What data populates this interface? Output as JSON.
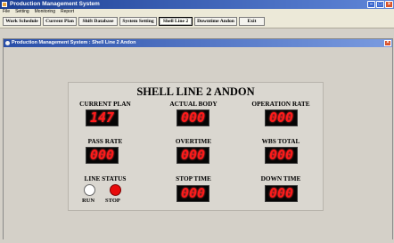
{
  "window": {
    "title": "Production Management System"
  },
  "menu": [
    "File",
    "Setting",
    "Monitoring",
    "Report"
  ],
  "toolbar": [
    {
      "label": "Work Schedule",
      "active": false
    },
    {
      "label": "Current Plan",
      "active": false
    },
    {
      "label": "Shift Database",
      "active": false
    },
    {
      "label": "System Setting",
      "active": false
    },
    {
      "label": "Shell Line 2",
      "active": true
    },
    {
      "label": "Downtime Andon",
      "active": false
    },
    {
      "label": "Exit",
      "active": false
    }
  ],
  "child_window": {
    "title": "Production Management System : Shell Line 2 Andon"
  },
  "andon": {
    "title": "SHELL LINE 2 ANDON",
    "current_plan": {
      "label": "CURRENT PLAN",
      "value": "147"
    },
    "actual_body": {
      "label": "ACTUAL BODY",
      "value": "000"
    },
    "operation_rate": {
      "label": "OPERATION RATE",
      "value": "000"
    },
    "pass_rate": {
      "label": "PASS RATE",
      "value": "000"
    },
    "overtime": {
      "label": "OVERTIME",
      "value": "000"
    },
    "wbs_total": {
      "label": "WBS TOTAL",
      "value": "000"
    },
    "line_status": {
      "label": "LINE STATUS",
      "run_label": "RUN",
      "stop_label": "STOP",
      "state": "stop"
    },
    "stop_time": {
      "label": "STOP TIME",
      "value": "000"
    },
    "down_time": {
      "label": "DOWN TIME",
      "value": "000"
    }
  },
  "colors": {
    "display_bg": "#050505",
    "display_digits": "#ff1a1a",
    "stop_lamp": "#e80a0a",
    "run_lamp": "#ffffff"
  }
}
